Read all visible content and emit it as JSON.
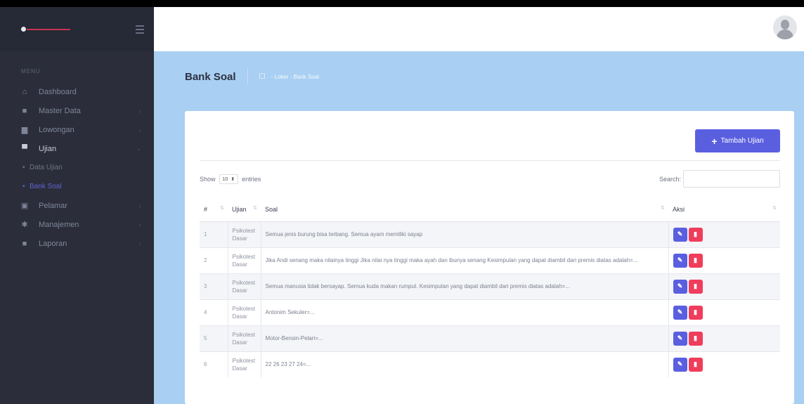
{
  "sidebar": {
    "menu_header": "MENU",
    "items": [
      {
        "label": "Dashboard",
        "icon": "home-icon"
      },
      {
        "label": "Master Data",
        "icon": "folder-icon"
      },
      {
        "label": "Lowongan",
        "icon": "briefcase-icon"
      },
      {
        "label": "Ujian",
        "icon": "monitor-icon"
      },
      {
        "label": "Pelamar",
        "icon": "id-card-icon"
      },
      {
        "label": "Manajemen",
        "icon": "gear-icon"
      },
      {
        "label": "Laporan",
        "icon": "folder-icon"
      }
    ],
    "sub_items": [
      {
        "label": "Data Ujian"
      },
      {
        "label": "Bank Soal"
      }
    ]
  },
  "page": {
    "title": "Bank Soal",
    "breadcrumb": "- Loker - Bank Soal"
  },
  "card": {
    "add_button": "Tambah Ujian",
    "show_label": "Show",
    "entries_value": "10",
    "entries_label": "entries",
    "search_label": "Search:"
  },
  "table": {
    "headers": [
      "#",
      "Ujian",
      "Soal",
      "Aksi"
    ],
    "rows": [
      {
        "no": "1",
        "ujian": "Psikotest Dasar",
        "soal": "Semua jenis burung bisa terbang. Semua ayam memiliki sayap"
      },
      {
        "no": "2",
        "ujian": "Psikotest Dasar",
        "soal": "Jika Andi senang maka nilainya tinggi Jika nilai nya tinggi maka ayah dan ibunya senang Kesimpulan yang dapat diambil dari premis diatas adalah=..."
      },
      {
        "no": "3",
        "ujian": "Psikotest Dasar",
        "soal": "Semua manusia tidak bersayap. Semua kuda makan rumput. Kesimpulan yang dapat diambil dari premis diatas adalah=..."
      },
      {
        "no": "4",
        "ujian": "Psikotest Dasar",
        "soal": "Antonim Sekuler=..."
      },
      {
        "no": "5",
        "ujian": "Psikotest Dasar",
        "soal": "Motor-Bensin-Pelari=..."
      },
      {
        "no": "6",
        "ujian": "Psikotest Dasar",
        "soal": "22 26 23 27 24=..."
      }
    ]
  },
  "colors": {
    "sidebar_bg": "#2b2e3a",
    "main_bg": "#a9cff2",
    "accent": "#5a5fe0",
    "danger": "#f03d5c"
  }
}
